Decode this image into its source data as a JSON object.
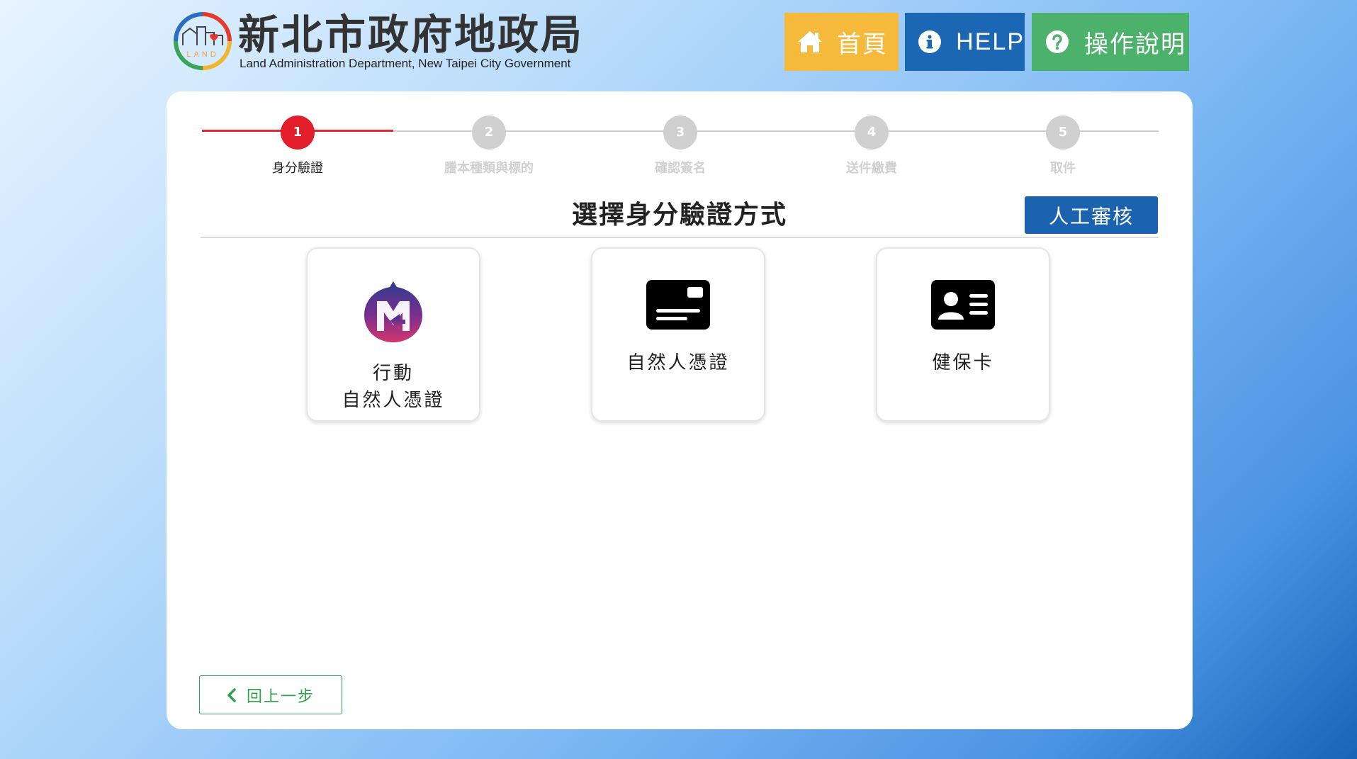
{
  "header": {
    "logo_text_zh": "新北市政府地政局",
    "logo_text_en": "Land Administration Department, New Taipei City Government",
    "logo_mark_text": "LAND",
    "buttons": [
      {
        "label": "首頁",
        "icon": "home-icon",
        "color": "#f5b93c"
      },
      {
        "label": "HELP",
        "icon": "info-icon",
        "color": "#1c67b3"
      },
      {
        "label": "操作說明",
        "icon": "question-icon",
        "color": "#4bb16b"
      }
    ]
  },
  "stepper": {
    "current_step": 1,
    "steps": [
      {
        "number": "1",
        "label": "身分驗證"
      },
      {
        "number": "2",
        "label": "謄本種類與標的"
      },
      {
        "number": "3",
        "label": "確認簽名"
      },
      {
        "number": "4",
        "label": "送件繳費"
      },
      {
        "number": "5",
        "label": "取件"
      }
    ],
    "active_color": "#e31e2a"
  },
  "main": {
    "heading": "選擇身分驗證方式",
    "manual_review_label": "人工審核",
    "options": [
      {
        "line1": "行動",
        "line2": "自然人憑證",
        "icon": "mobile-citizen-certificate-icon"
      },
      {
        "line1": "自然人憑證",
        "icon": "citizen-card-icon"
      },
      {
        "line1": "健保卡",
        "icon": "health-id-card-icon"
      }
    ]
  },
  "footer": {
    "back_label": "回上一步",
    "back_icon": "chevron-left-icon"
  }
}
